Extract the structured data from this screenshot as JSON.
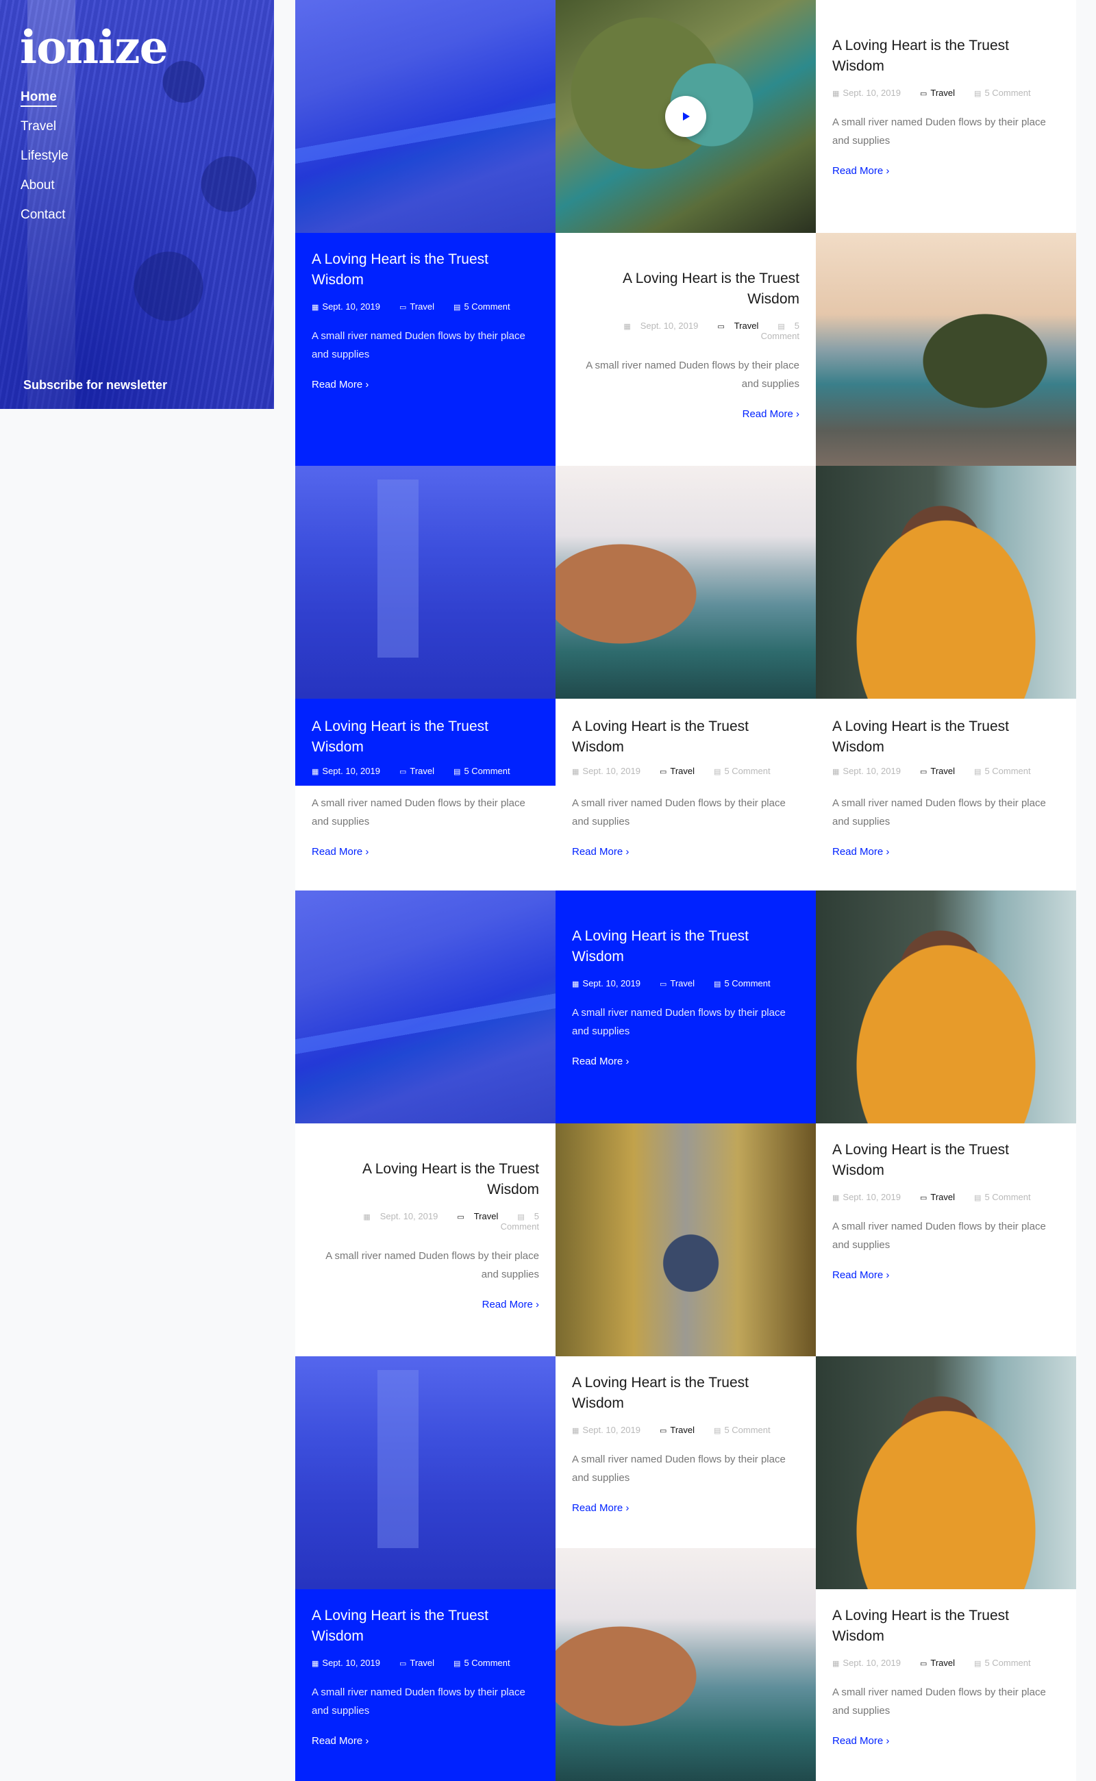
{
  "site": {
    "logo": "ionize"
  },
  "nav": {
    "items": [
      "Home",
      "Travel",
      "Lifestyle",
      "About",
      "Contact"
    ],
    "active": "Home"
  },
  "sidebar": {
    "subscribe": "Subscribe for newsletter"
  },
  "post": {
    "title": "A Loving Heart is the Truest Wisdom",
    "date": "Sept. 10, 2019",
    "category": "Travel",
    "comments": "5 Comment",
    "excerpt": "A small river named Duden flows by their place and supplies",
    "read_more": "Read More"
  },
  "colors": {
    "accent": "#0022ff",
    "white": "#ffffff",
    "muted": "#777777"
  },
  "icons": {
    "date": "calendar-icon",
    "category": "folder-icon",
    "comments": "chat-icon",
    "play": "play-icon",
    "read_more": "chevron-right-icon"
  }
}
